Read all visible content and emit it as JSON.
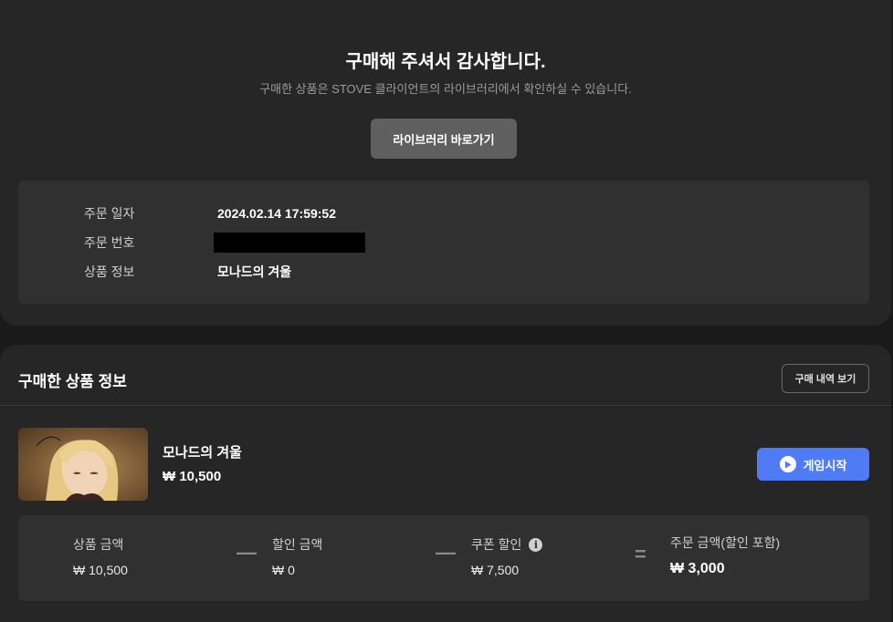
{
  "header": {
    "title": "구매해 주셔서 감사합니다.",
    "subtitle": "구매한 상품은 STOVE 클라이언트의 라이브러리에서 확인하실 수 있습니다.",
    "library_button": "라이브러리 바로가기"
  },
  "order": {
    "date_label": "주문 일자",
    "date_value": "2024.02.14 17:59:52",
    "number_label": "주문 번호",
    "product_label": "상품 정보",
    "product_value": "모나드의 겨울"
  },
  "purchased": {
    "section_title": "구매한 상품 정보",
    "history_button": "구매 내역 보기",
    "product_name": "모나드의 겨울",
    "product_price": "₩ 10,500",
    "play_button": "게임시작"
  },
  "pricing": {
    "product_amount_label": "상품 금액",
    "product_amount_value": "₩ 10,500",
    "minus1": "—",
    "discount_label": "할인 금액",
    "discount_value": "₩ 0",
    "minus2": "—",
    "coupon_label": "쿠폰 할인",
    "coupon_value": "₩ 7,500",
    "equals": "=",
    "total_label": "주문 금액(할인 포함)",
    "total_value": "₩ 3,000"
  },
  "colors": {
    "accent": "#4f7bf7",
    "panel": "#262626",
    "box": "#303030"
  }
}
